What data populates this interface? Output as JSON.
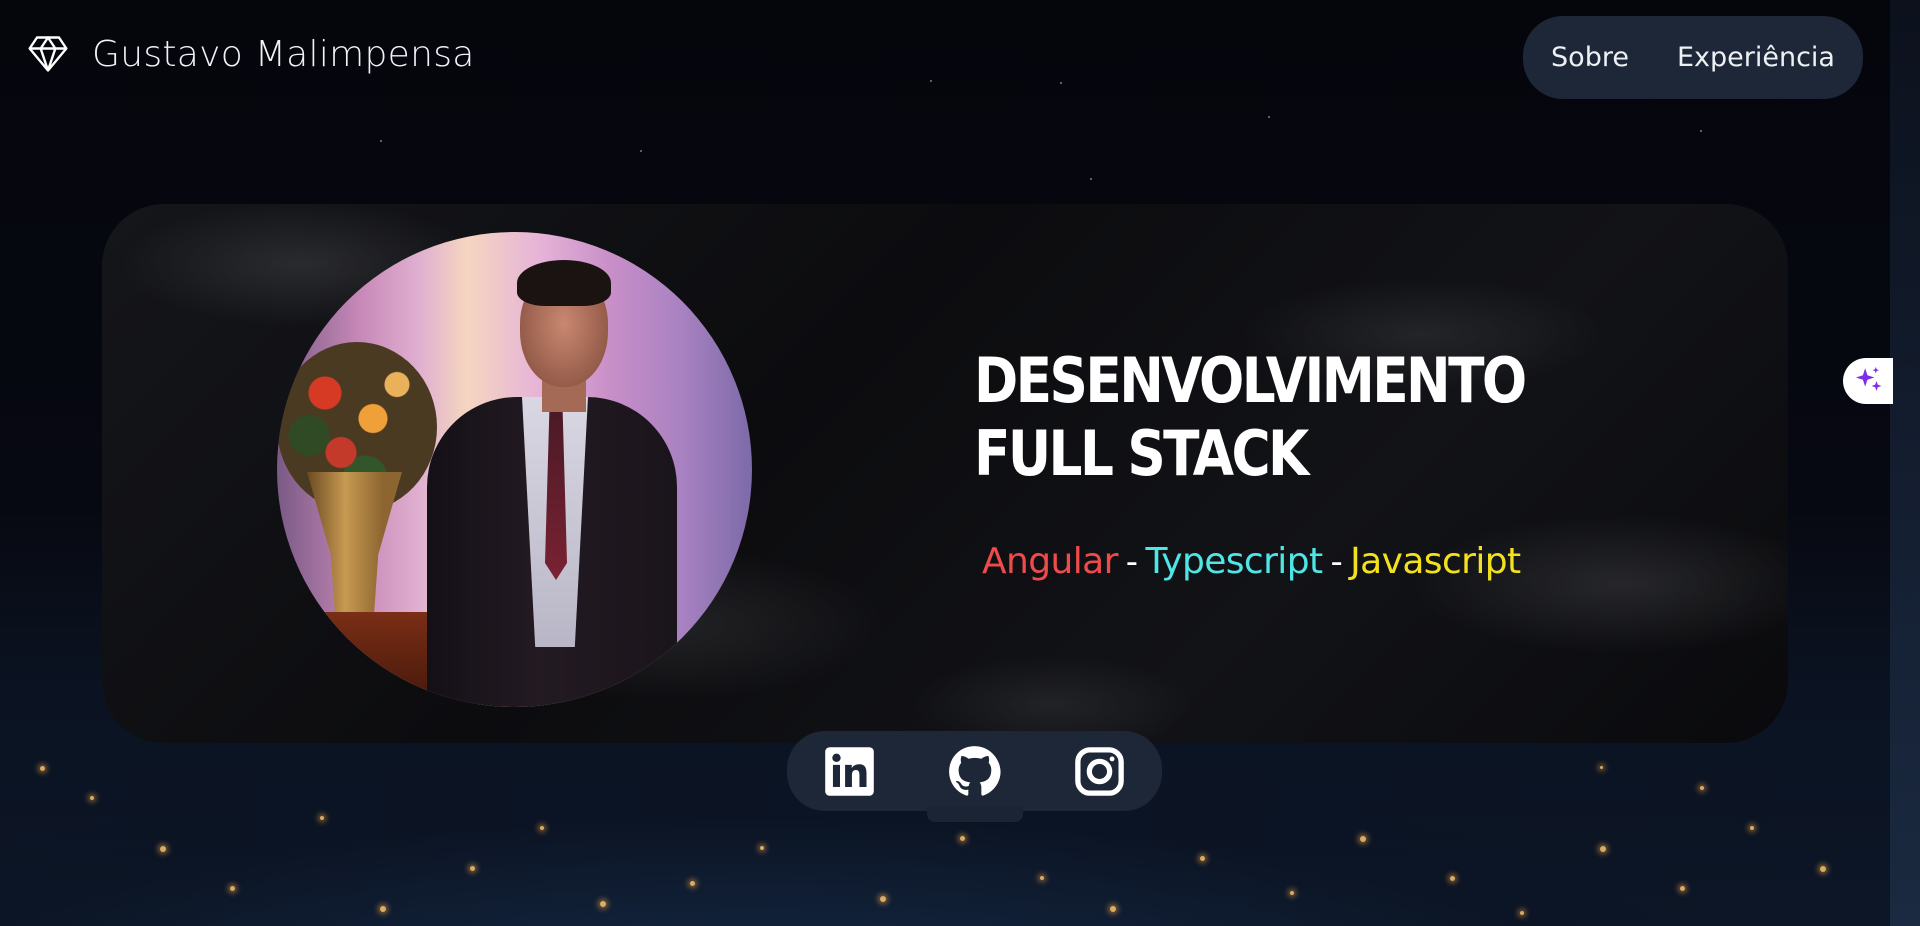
{
  "header": {
    "brand_icon": "diamond-icon",
    "brand_name": "Gustavo Malimpensa",
    "nav": [
      {
        "label": "Sobre"
      },
      {
        "label": "Experiência"
      }
    ]
  },
  "hero": {
    "headline": "Desenvolvimento Full Stack",
    "photo_icon": "profile-photo",
    "stack": [
      {
        "label": "Angular",
        "color": "#ef4b4b"
      },
      {
        "label": "Typescript",
        "color": "#4ee6e6"
      },
      {
        "label": "Javascript",
        "color": "#f3e11d"
      }
    ],
    "separator": "-"
  },
  "social": [
    {
      "icon": "linkedin-icon"
    },
    {
      "icon": "github-icon"
    },
    {
      "icon": "instagram-icon"
    }
  ],
  "floating": {
    "icon": "sparkle-icon",
    "color": "#7c2ee8"
  },
  "colors": {
    "background": "#06070d",
    "nav_pill": "#1d2738",
    "text": "#ffffff"
  }
}
